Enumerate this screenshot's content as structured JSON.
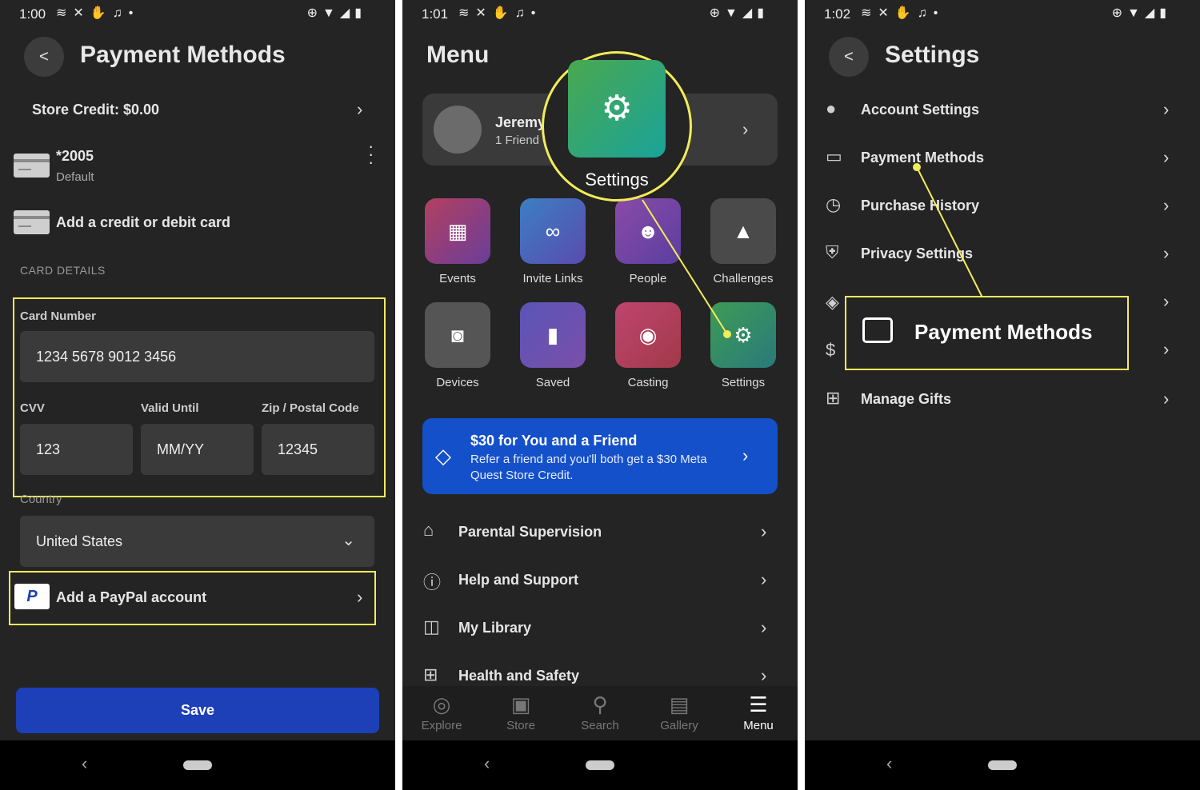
{
  "colors": {
    "accent_yellow": "#f2ec5a",
    "save_blue": "#1d3fb8",
    "promo_blue": "#1450c9",
    "panel_bg": "#242424"
  },
  "screen1": {
    "status_time": "1:00",
    "title": "Payment Methods",
    "store_credit": "Store Credit: $0.00",
    "card_number": "*2005",
    "card_default": "Default",
    "add_card": "Add a credit or debit card",
    "section": "CARD DETAILS",
    "card_number_label": "Card Number",
    "card_number_value": "1234 5678 9012 3456",
    "cvv_label": "CVV",
    "cvv_value": "123",
    "valid_label": "Valid Until",
    "valid_value": "MM/YY",
    "zip_label": "Zip / Postal Code",
    "zip_value": "12345",
    "country_label": "Country",
    "country_value": "United States",
    "paypal": "Add a PayPal account",
    "save": "Save"
  },
  "screen2": {
    "status_time": "1:01",
    "title": "Menu",
    "profile_name": "Jeremy",
    "profile_sub": "1 Friend",
    "callout": "Settings",
    "tiles": [
      {
        "label": "Events",
        "icon": "calendar-icon"
      },
      {
        "label": "Invite Links",
        "icon": "link-icon"
      },
      {
        "label": "People",
        "icon": "people-icon"
      },
      {
        "label": "Challenges",
        "icon": "mountain-icon"
      },
      {
        "label": "Devices",
        "icon": "headset-icon"
      },
      {
        "label": "Saved",
        "icon": "bookmark-icon"
      },
      {
        "label": "Casting",
        "icon": "cast-icon"
      },
      {
        "label": "Settings",
        "icon": "gear-icon"
      }
    ],
    "promo_title": "$30 for You and a Friend",
    "promo_body": "Refer a friend and you'll both get a $30 Meta Quest Store Credit.",
    "list": [
      "Parental Supervision",
      "Help and Support",
      "My Library",
      "Health and Safety"
    ],
    "nav": [
      "Explore",
      "Store",
      "Search",
      "Gallery",
      "Menu"
    ]
  },
  "screen3": {
    "status_time": "1:02",
    "title": "Settings",
    "items": [
      "Account Settings",
      "Payment Methods",
      "Purchase History",
      "Privacy Settings",
      "Manage Gifts"
    ],
    "callout": "Payment Methods"
  }
}
